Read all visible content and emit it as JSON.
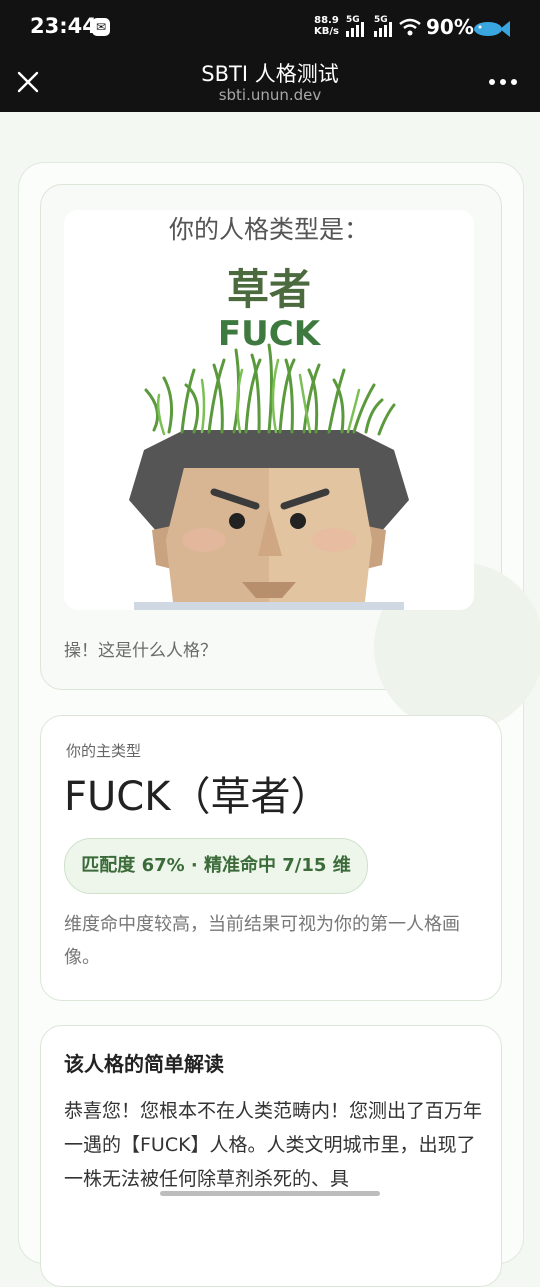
{
  "status_bar": {
    "time": "23:44",
    "net_speed_value": "88.9",
    "net_speed_unit": "KB/s",
    "signal1_label": "5G",
    "signal2_label": "5G",
    "battery": "90%",
    "icons": [
      "app-notification-icon",
      "signal-icon",
      "wifi-icon",
      "fish-icon"
    ]
  },
  "browser": {
    "title": "SBTI 人格测试",
    "url": "sbti.unun.dev",
    "icons": [
      "close-icon",
      "more-icon"
    ]
  },
  "result_card": {
    "image_heading": "你的人格类型是：",
    "image_type_cn": "草者",
    "image_type_en": "FUCK",
    "caption": "操！这是什么人格？"
  },
  "main_type": {
    "label": "你的主类型",
    "name": "FUCK（草者）",
    "match_text": "匹配度 67% · 精准命中 7/15 维",
    "match_percent": 67,
    "dims_hit": 7,
    "dims_total": 15,
    "description": "维度命中度较高，当前结果可视为你的第一人格画像。"
  },
  "interpretation": {
    "title": "该人格的简单解读",
    "body": "恭喜您！您根本不在人类范畴内！您测出了百万年一遇的【FUCK】人格。人类文明城市里，出现了一株无法被任何除草剂杀死的、具"
  },
  "colors": {
    "accent_green": "#3e7a40",
    "page_bg": "#f4f8f3",
    "bar_bg": "#121212"
  }
}
